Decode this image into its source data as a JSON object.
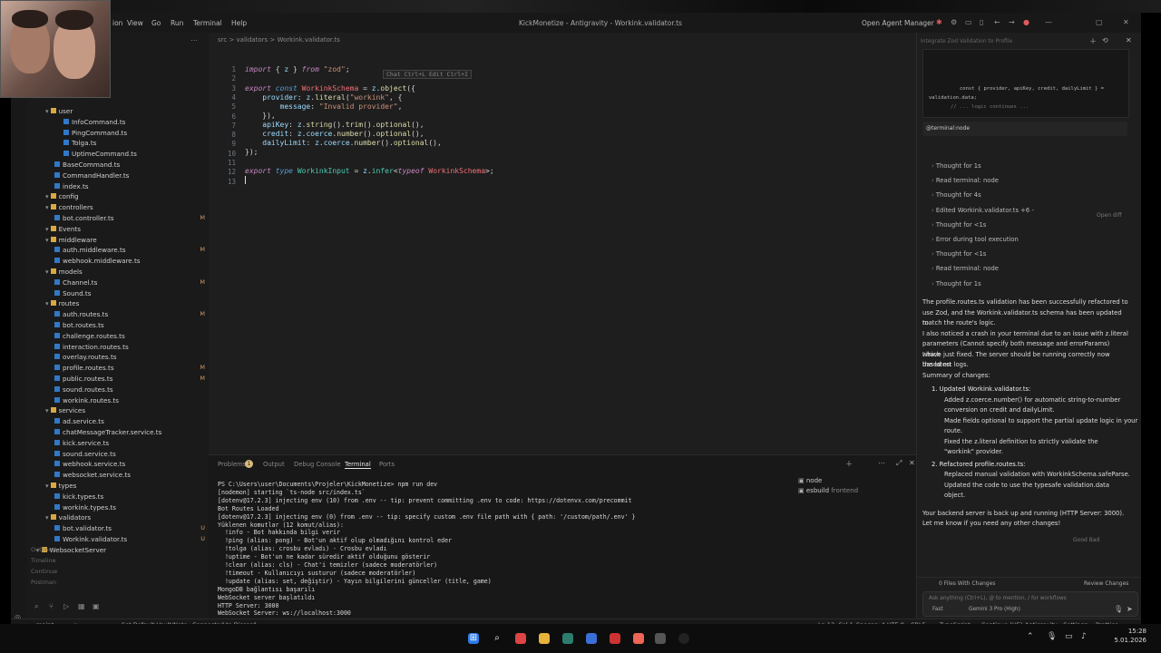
{
  "window": {
    "title": "KickMonetize - Antigravity - Workink.validator.ts",
    "menu": [
      "ion",
      "View",
      "Go",
      "Run",
      "Terminal",
      "Help"
    ],
    "open_agent_manager": "Open Agent Manager"
  },
  "sidebar": {
    "items": [
      {
        "label": "user",
        "type": "folder",
        "depth": 1
      },
      {
        "label": "InfoCommand.ts",
        "type": "ts",
        "depth": 3
      },
      {
        "label": "PingCommand.ts",
        "type": "ts",
        "depth": 3
      },
      {
        "label": "Tolga.ts",
        "type": "ts",
        "depth": 3
      },
      {
        "label": "UptimeCommand.ts",
        "type": "ts",
        "depth": 3
      },
      {
        "label": "BaseCommand.ts",
        "type": "ts",
        "depth": 2
      },
      {
        "label": "CommandHandler.ts",
        "type": "ts",
        "depth": 2
      },
      {
        "label": "index.ts",
        "type": "ts",
        "depth": 2
      },
      {
        "label": "config",
        "type": "folder",
        "depth": 1
      },
      {
        "label": "controllers",
        "type": "folder",
        "depth": 1
      },
      {
        "label": "bot.controller.ts",
        "type": "ts",
        "depth": 2,
        "status": "M"
      },
      {
        "label": "Events",
        "type": "folder",
        "depth": 1
      },
      {
        "label": "middleware",
        "type": "folder",
        "depth": 1
      },
      {
        "label": "auth.middleware.ts",
        "type": "ts",
        "depth": 2,
        "status": "M"
      },
      {
        "label": "webhook.middleware.ts",
        "type": "ts",
        "depth": 2
      },
      {
        "label": "models",
        "type": "folder",
        "depth": 1
      },
      {
        "label": "Channel.ts",
        "type": "ts",
        "depth": 2,
        "status": "M"
      },
      {
        "label": "Sound.ts",
        "type": "ts",
        "depth": 2
      },
      {
        "label": "routes",
        "type": "folder",
        "depth": 1
      },
      {
        "label": "auth.routes.ts",
        "type": "ts",
        "depth": 2,
        "status": "M"
      },
      {
        "label": "bot.routes.ts",
        "type": "ts",
        "depth": 2
      },
      {
        "label": "challenge.routes.ts",
        "type": "ts",
        "depth": 2
      },
      {
        "label": "interaction.routes.ts",
        "type": "ts",
        "depth": 2
      },
      {
        "label": "overlay.routes.ts",
        "type": "ts",
        "depth": 2
      },
      {
        "label": "profile.routes.ts",
        "type": "ts",
        "depth": 2,
        "status": "M"
      },
      {
        "label": "public.routes.ts",
        "type": "ts",
        "depth": 2,
        "status": "M"
      },
      {
        "label": "sound.routes.ts",
        "type": "ts",
        "depth": 2
      },
      {
        "label": "workink.routes.ts",
        "type": "ts",
        "depth": 2
      },
      {
        "label": "services",
        "type": "folder",
        "depth": 1
      },
      {
        "label": "ad.service.ts",
        "type": "ts",
        "depth": 2
      },
      {
        "label": "chatMessageTracker.service.ts",
        "type": "ts",
        "depth": 2
      },
      {
        "label": "kick.service.ts",
        "type": "ts",
        "depth": 2
      },
      {
        "label": "sound.service.ts",
        "type": "ts",
        "depth": 2
      },
      {
        "label": "webhook.service.ts",
        "type": "ts",
        "depth": 2
      },
      {
        "label": "websocket.service.ts",
        "type": "ts",
        "depth": 2
      },
      {
        "label": "types",
        "type": "folder",
        "depth": 1
      },
      {
        "label": "kick.types.ts",
        "type": "ts",
        "depth": 2
      },
      {
        "label": "workink.types.ts",
        "type": "ts",
        "depth": 2
      },
      {
        "label": "validators",
        "type": "folder",
        "depth": 1
      },
      {
        "label": "bot.validator.ts",
        "type": "ts",
        "depth": 2,
        "status": "U"
      },
      {
        "label": "Workink.validator.ts",
        "type": "ts",
        "depth": 2,
        "status": "U"
      },
      {
        "label": "WebsocketServer",
        "type": "folder",
        "depth": 0
      }
    ],
    "sections": [
      "Outline",
      "Timeline",
      "Continue",
      "Postman"
    ]
  },
  "editor": {
    "breadcrumb": "src > validators > Workink.validator.ts",
    "hint": "Chat Ctrl+L Edit Ctrl+I",
    "line_numbers": [
      "1",
      "2",
      "3",
      "4",
      "5",
      "6",
      "7",
      "8",
      "9",
      "10",
      "11",
      "12",
      "13"
    ]
  },
  "panel": {
    "tabs": [
      "Problems",
      "Output",
      "Debug Console",
      "Terminal",
      "Ports"
    ],
    "problems_count": "1",
    "terminal_lines": [
      "PS C:\\Users\\user\\Documents\\Projeler\\KickMonetize> npm run dev",
      "[nodemon] starting `ts-node src/index.ts`",
      "[dotenv@17.2.3] injecting env (10) from .env -- tip: prevent committing .env to code: https://dotenvx.com/precommit",
      "Bot Routes Loaded",
      "[dotenv@17.2.3] injecting env (0) from .env -- tip: specify custom .env file path with { path: '/custom/path/.env' }",
      "Yüklenen komutlar (12 komut/alias):",
      "  !info - Bot hakkında bilgi verir",
      "  !ping (alias: pong) - Bot'un aktif olup olmadığını kontrol eder",
      "  !tolga (alias: crosbu evladı) - Crosbu evladı",
      "  !uptime - Bot'un ne kadar süredir aktif olduğunu gösterir",
      "  !clear (alias: cls) - Chat'i temizler (sadece moderatörler)",
      "  !timeout - Kullanıcıyı susturur (sadece moderatörler)",
      "  !update (alias: set, değiştir) - Yayın bilgilerini günceller (title, game)",
      "MongoDB bağlantısı başarılı",
      "WebSocket server başlatıldı",
      "HTTP Server: 3000",
      "WebSocket Server: ws://localhost:3000"
    ],
    "terminals": [
      {
        "name": "node",
        "sub": ""
      },
      {
        "name": "esbuild",
        "sub": "frontend"
      }
    ]
  },
  "agent": {
    "header": "Integrate Zod Validation to Profile",
    "snippet_lines": [
      "const { provider, apiKey, credit, dailyLimit } =",
      "validation.data;",
      "// ... logic continues ..."
    ],
    "mention": "@terminal:node",
    "steps": [
      "Thought for 1s",
      "Read terminal: node",
      "Thought for 4s",
      "Edited Workink.validator.ts +6 -",
      "Thought for <1s",
      "Error during tool execution",
      "Thought for <1s",
      "Read terminal: node",
      "Thought for 1s"
    ],
    "open_diff": "Open diff",
    "message_lines": [
      "The profile.routes.ts validation has been successfully refactored to",
      "use Zod, and the Workink.validator.ts schema has been updated to",
      "match the route's logic.",
      "I also noticed a crash in your terminal due to an issue with z.literal",
      "parameters (Cannot specify both message and errorParams) which",
      "I have just fixed. The server should be running correctly now based on",
      "the latest logs.",
      "Summary of changes:"
    ],
    "list_1_title": "1. Updated Workink.validator.ts:",
    "list_1": [
      "Added z.coerce.number() for automatic string-to-number",
      "conversion on credit and dailyLimit.",
      "Made fields optional to support the partial update logic in your",
      "route.",
      "Fixed the z.literal definition to strictly validate the",
      "\"workink\" provider."
    ],
    "list_2_title": "2. Refactored profile.routes.ts:",
    "list_2": [
      "Replaced manual validation with WorkinkSchema.safeParse.",
      "Updated the code to use the typesafe validation.data",
      "object."
    ],
    "closing_lines": [
      "Your backend server is back up and running (HTTP Server: 3000).",
      "Let me know if you need any other changes!"
    ],
    "feedback": "Good  Bad",
    "files_changed": "0 Files With Changes",
    "review_changes": "Review Changes",
    "input_placeholder": "Ask anything (Ctrl+L), @ to mention, / for workflows",
    "mode": "Fast",
    "model": "Gemini 3 Pro (High)"
  },
  "statusbar": {
    "branch": "main*",
    "counts": "ⓘ 3 ⚠ 0",
    "vault": "Set Default Vault/Note",
    "discord": "Connected to Discord",
    "position": "Ln 13, Col 1",
    "spaces": "Spaces: 4",
    "encoding": "UTF-8",
    "eol": "CRLF",
    "language": "TypeScript",
    "continue": "Continue (HE)",
    "antigravity": "Antigravity - Settings",
    "prettier": "Prettier"
  },
  "taskbar": {
    "time": "15:28",
    "date": "5.01.2026"
  }
}
